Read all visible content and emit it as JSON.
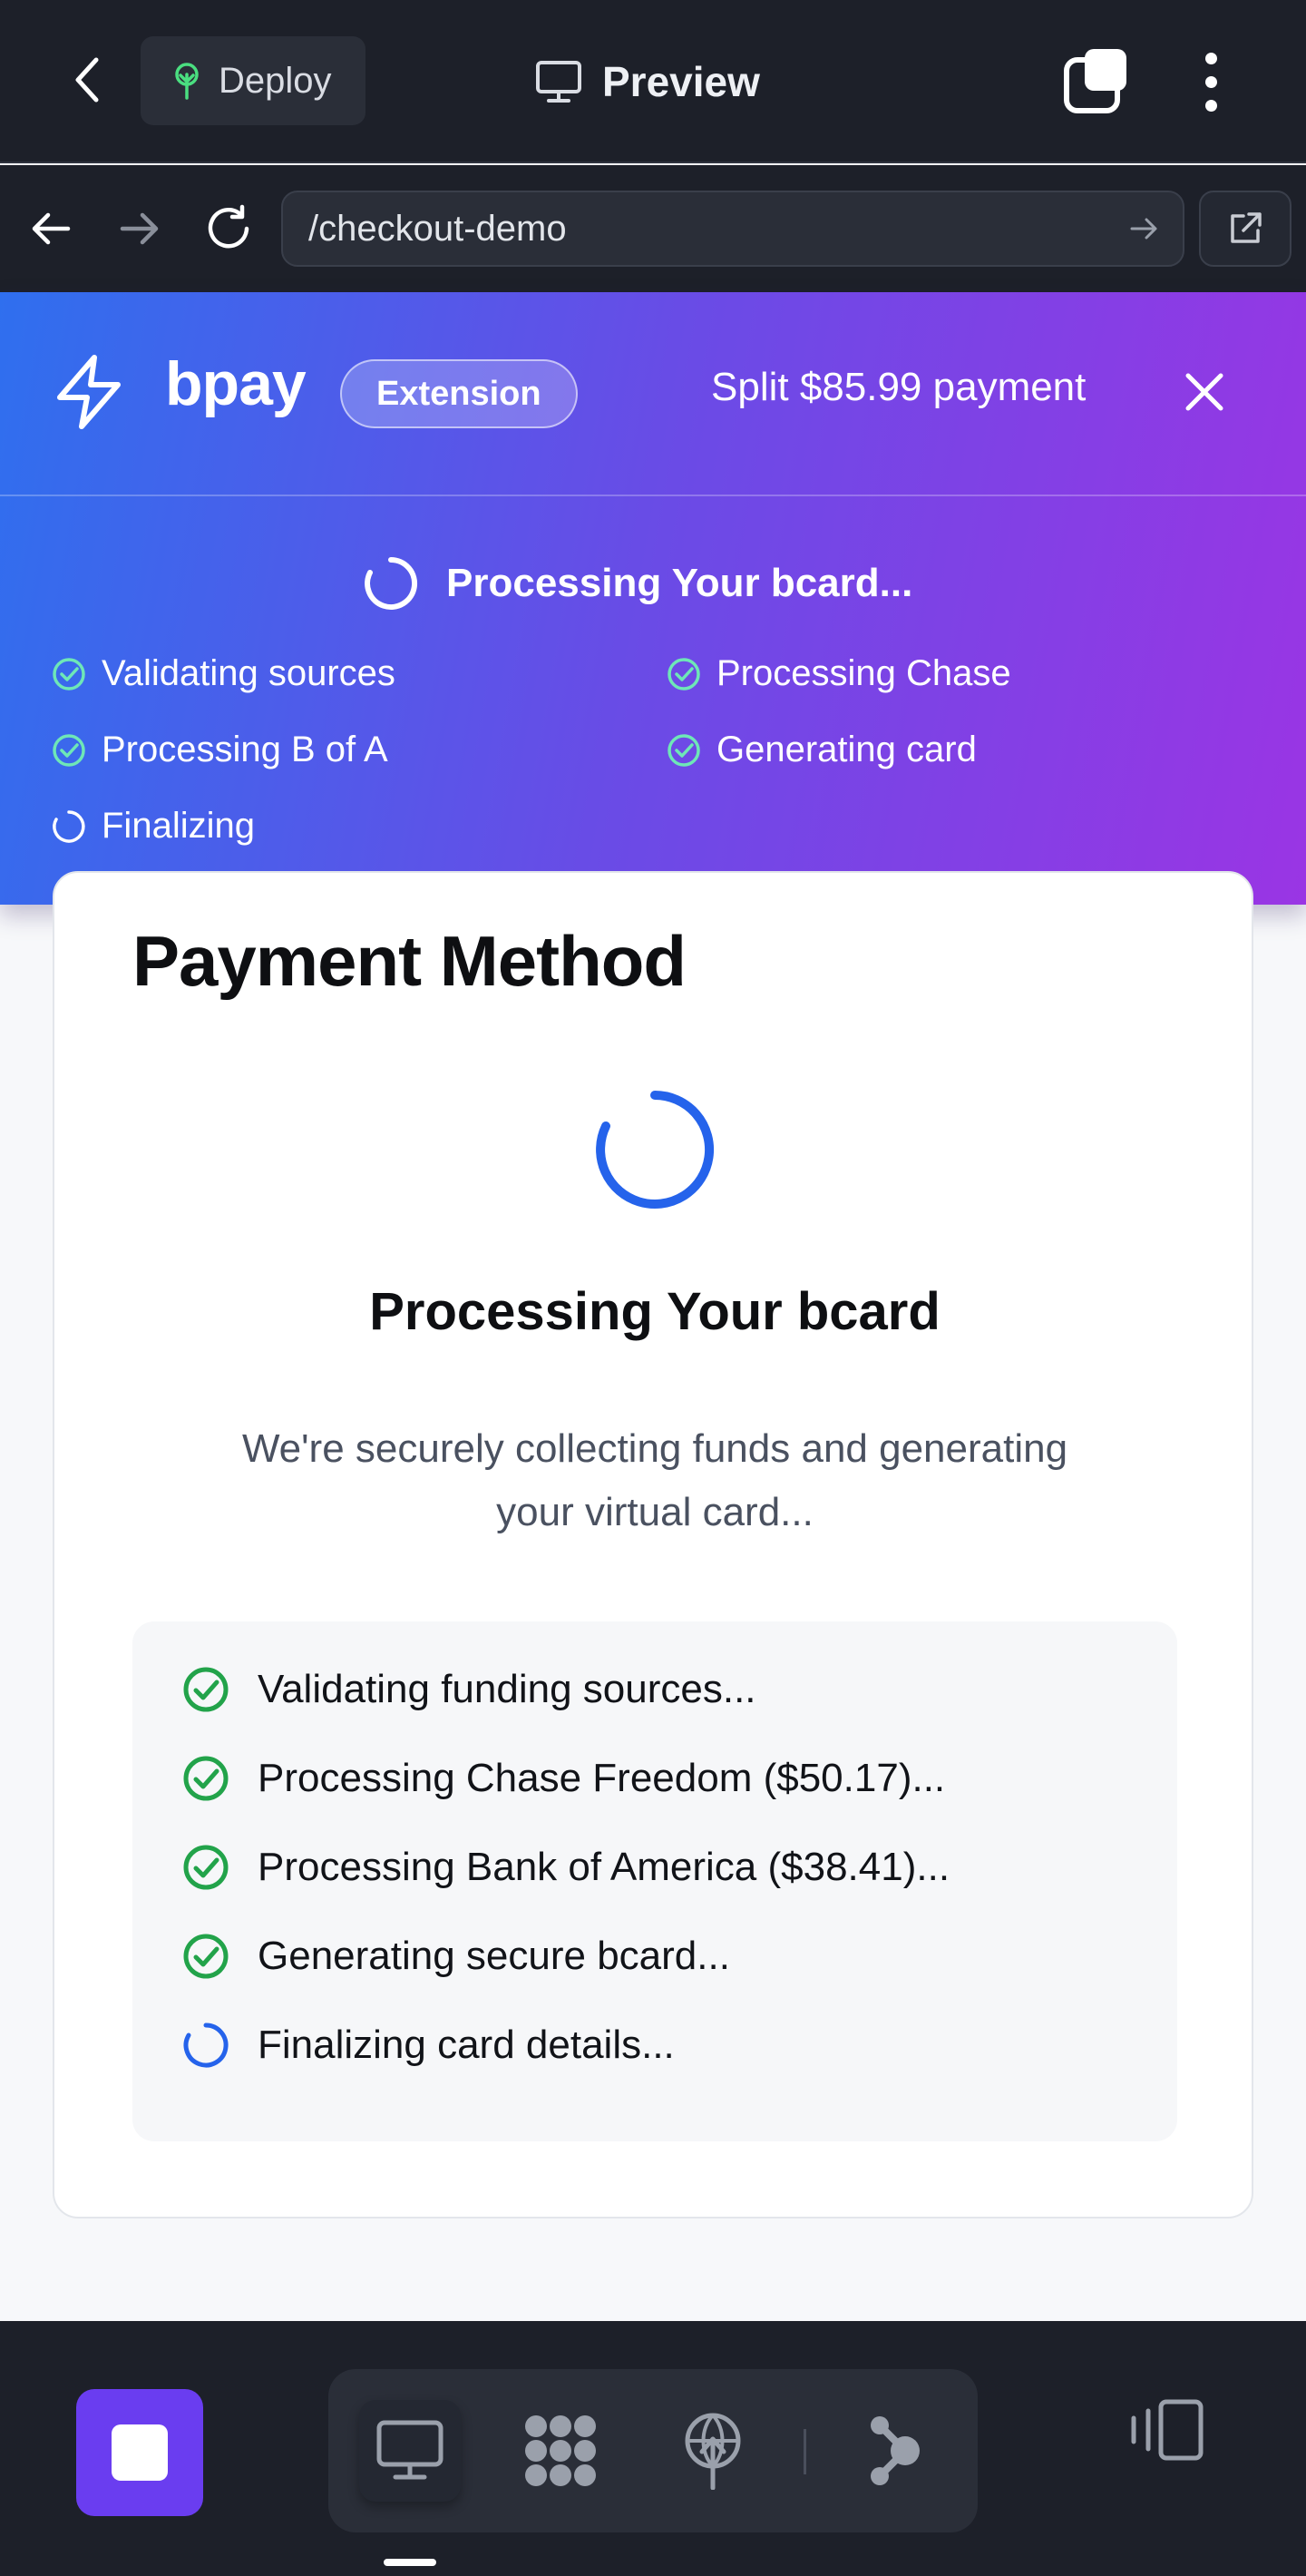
{
  "topbar": {
    "deploy_label": "Deploy",
    "preview_label": "Preview"
  },
  "browser": {
    "url": "/checkout-demo"
  },
  "extension": {
    "brand": "bpay",
    "badge": "Extension",
    "split_text": "Split $85.99 payment",
    "processing_title": "Processing Your bcard...",
    "steps": [
      {
        "label": "Validating sources",
        "status": "done"
      },
      {
        "label": "Processing Chase",
        "status": "done"
      },
      {
        "label": "Processing B of A",
        "status": "done"
      },
      {
        "label": "Generating card",
        "status": "done"
      },
      {
        "label": "Finalizing",
        "status": "loading"
      }
    ]
  },
  "card": {
    "title": "Payment Method",
    "processing_title": "Processing Your bcard",
    "subtitle": "We're securely collecting funds and generating your virtual card...",
    "steps": [
      {
        "label": "Validating funding sources...",
        "status": "done"
      },
      {
        "label": "Processing Chase Freedom ($50.17)...",
        "status": "done"
      },
      {
        "label": "Processing Bank of America ($38.41)...",
        "status": "done"
      },
      {
        "label": "Generating secure bcard...",
        "status": "done"
      },
      {
        "label": "Finalizing card details...",
        "status": "loading"
      }
    ]
  },
  "colors": {
    "accent": "#2f6fee",
    "success": "#22a34a",
    "stop": "#6a3df0"
  },
  "icons": [
    "chevron-left-icon",
    "sprout-icon",
    "monitor-icon",
    "tabs-icon",
    "more-vertical-icon",
    "arrow-left-icon",
    "arrow-right-icon",
    "refresh-icon",
    "external-link-icon",
    "lightning-icon",
    "close-icon",
    "spinner-icon",
    "check-circle-icon",
    "stop-icon",
    "apps-icon",
    "globe-icon",
    "stream-icon",
    "devices-icon"
  ]
}
